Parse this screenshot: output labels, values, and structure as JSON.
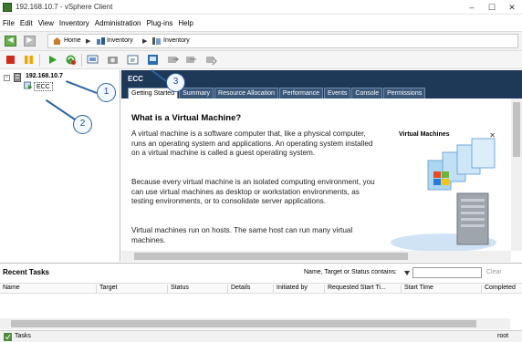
{
  "window": {
    "title": "192.168.10.7 - vSphere Client"
  },
  "menu": [
    "File",
    "Edit",
    "View",
    "Inventory",
    "Administration",
    "Plug-ins",
    "Help"
  ],
  "breadcrumb": {
    "home": "Home",
    "inventory1": "Inventory",
    "inventory2": "Inventory"
  },
  "tree": {
    "host": "192.168.10.7",
    "vm": "ECC"
  },
  "panel": {
    "title": "ECC",
    "tabs": [
      "Getting Started",
      "Summary",
      "Resource Allocation",
      "Performance",
      "Events",
      "Console",
      "Permissions"
    ]
  },
  "content": {
    "heading": "What is a Virtual Machine?",
    "p1": "A virtual machine is a software computer that, like a physical computer, runs an operating system and applications. An operating system installed on a virtual machine is called a guest operating system.",
    "p2": "Because every virtual machine is an isolated computing environment, you can use virtual machines as desktop or workstation environments, as testing environments, or to consolidate server applications.",
    "p3": "Virtual machines run on hosts. The same host can run many virtual machines.",
    "graphic_caption": "Virtual Machines"
  },
  "recent_tasks": {
    "title": "Recent Tasks",
    "filter_label": "Name, Target or Status contains: ",
    "clear": "Clear",
    "columns": [
      "Name",
      "Target",
      "Status",
      "Details",
      "Initiated by",
      "Requested Start Ti...",
      "Start Time",
      "Completed"
    ]
  },
  "status": {
    "tasks": "Tasks",
    "user": "root"
  },
  "callouts": [
    "1",
    "2",
    "3"
  ],
  "colors": {
    "header": "#1e3858",
    "tab": "#3a577a",
    "callout": "#2c63a0"
  }
}
